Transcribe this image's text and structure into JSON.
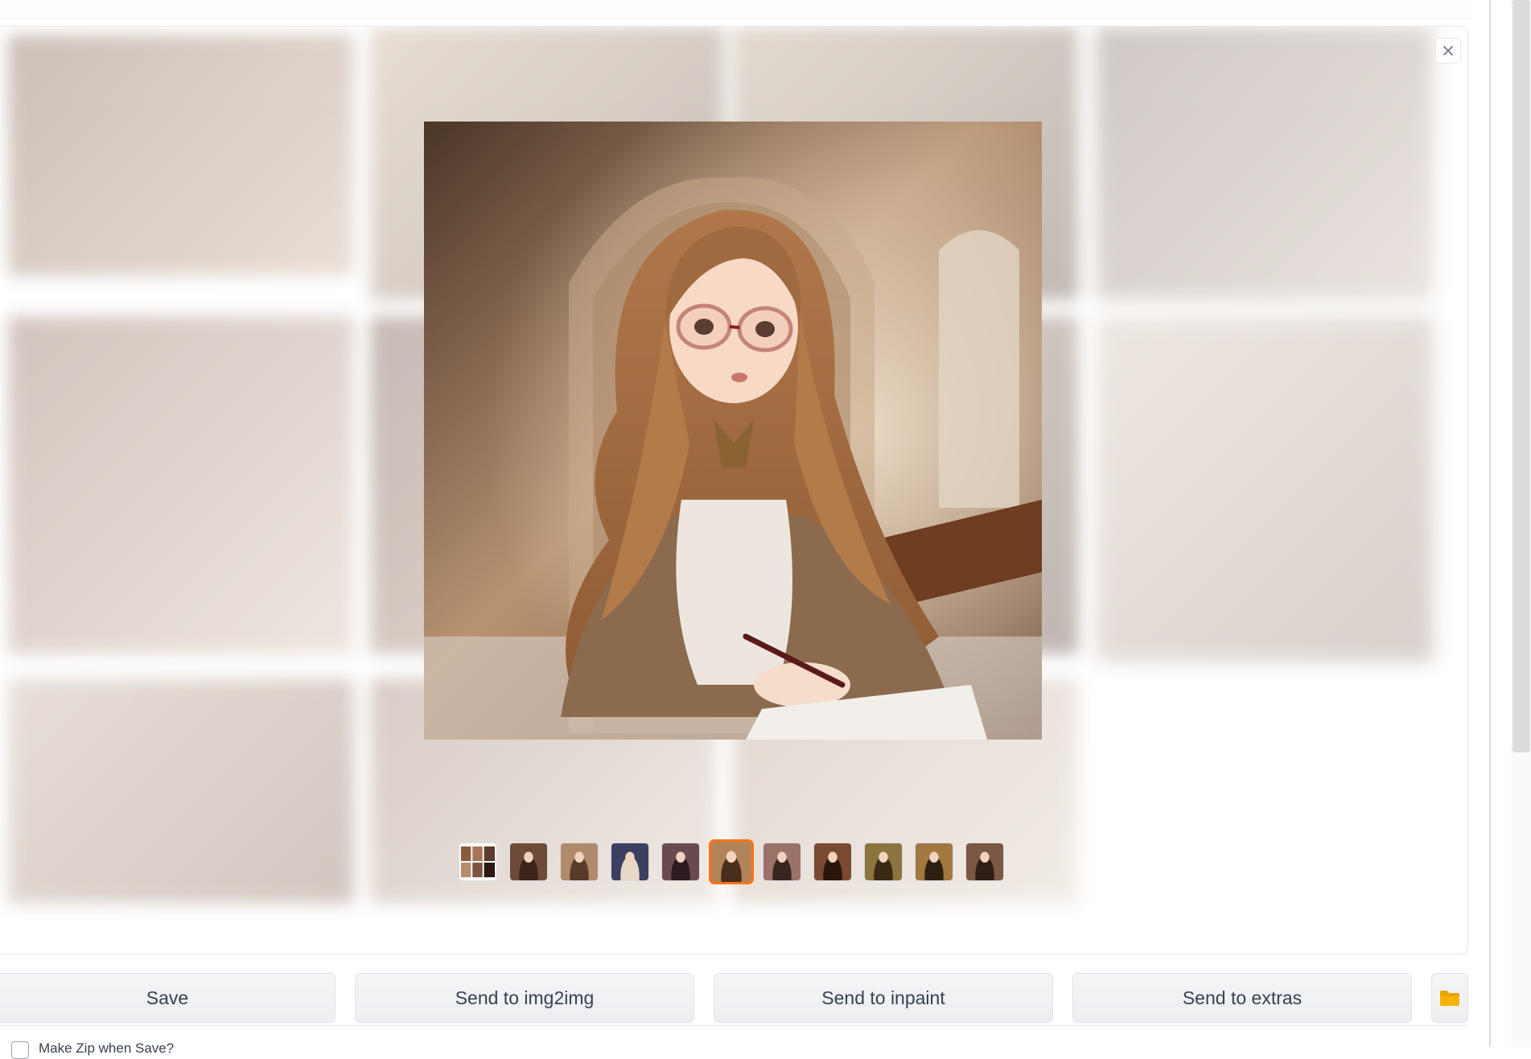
{
  "gallery": {
    "close_icon": "close-icon",
    "selected_index": 5,
    "thumbnails": [
      {
        "name": "grid-thumbnail",
        "palette": [
          "#8a5b3e",
          "#2a1a12"
        ]
      },
      {
        "name": "portrait-thumbnail",
        "palette": [
          "#6e4a38",
          "#3b2419"
        ]
      },
      {
        "name": "portrait-thumbnail",
        "palette": [
          "#b08a6c",
          "#5a3a2a"
        ]
      },
      {
        "name": "portrait-thumbnail",
        "palette": [
          "#3c3f60",
          "#e8d8c8"
        ]
      },
      {
        "name": "portrait-thumbnail",
        "palette": [
          "#6a4a50",
          "#2c1c20"
        ]
      },
      {
        "name": "portrait-thumbnail",
        "palette": [
          "#b08358",
          "#4a2e1c"
        ]
      },
      {
        "name": "portrait-thumbnail",
        "palette": [
          "#9a7268",
          "#3a2420"
        ]
      },
      {
        "name": "portrait-thumbnail",
        "palette": [
          "#7a4a30",
          "#2a160c"
        ]
      },
      {
        "name": "portrait-thumbnail",
        "palette": [
          "#8c7440",
          "#3a2a14"
        ]
      },
      {
        "name": "portrait-thumbnail",
        "palette": [
          "#a07840",
          "#2e2010"
        ]
      },
      {
        "name": "portrait-thumbnail",
        "palette": [
          "#7a5844",
          "#2e1e16"
        ]
      }
    ]
  },
  "actions": {
    "save": "Save",
    "send_img2img": "Send to img2img",
    "send_inpaint": "Send to inpaint",
    "send_extras": "Send to extras",
    "open_folder_icon": "folder-icon"
  },
  "options": {
    "checkbox_label": "Make Zip when Save?"
  },
  "colors": {
    "selected_border": "#f97316",
    "annotation_underline": "#d81f1f",
    "folder": "#f5b301"
  }
}
